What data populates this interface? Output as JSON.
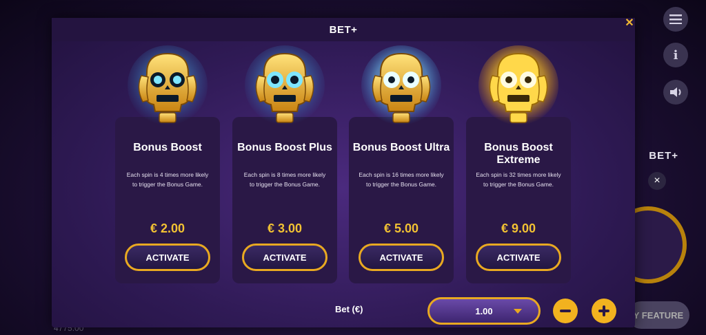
{
  "modal": {
    "title": "BET+"
  },
  "cards": [
    {
      "title": "Bonus Boost",
      "desc": "Each spin is 4 times more likely to trigger the Bonus Game.",
      "price": "€ 2.00",
      "button": "ACTIVATE",
      "glow": "#43c6ff"
    },
    {
      "title": "Bonus Boost Plus",
      "desc": "Each spin is 8 times more likely to trigger the Bonus Game.",
      "price": "€ 3.00",
      "button": "ACTIVATE",
      "glow": "#43c6ff"
    },
    {
      "title": "Bonus Boost Ultra",
      "desc": "Each spin is 16 times more likely to trigger the Bonus Game.",
      "price": "€ 5.00",
      "button": "ACTIVATE",
      "glow": "#6fd3ff"
    },
    {
      "title": "Bonus Boost Extreme",
      "desc": "Each spin is 32 times more likely to trigger the Bonus Game.",
      "price": "€ 9.00",
      "button": "ACTIVATE",
      "glow": "#ffd43b"
    }
  ],
  "bet": {
    "label": "Bet (€)",
    "value": "1.00"
  },
  "background": {
    "betplus": "BET+",
    "feature": "Y FEATURE",
    "balance": "4775.00"
  },
  "icons": {
    "close": "close-icon",
    "menu": "menu-icon",
    "info": "info-icon",
    "sound": "speaker-icon",
    "minus": "minus-icon",
    "plus": "plus-icon",
    "caret": "chevron-down-icon"
  },
  "colors": {
    "accent": "#e9a921",
    "price": "#f2c233",
    "modal_bg": "#2f1a55"
  }
}
